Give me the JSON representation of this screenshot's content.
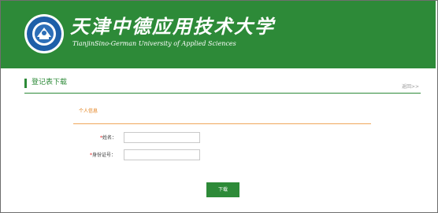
{
  "header": {
    "title_cn": "天津中德应用技术大学",
    "title_en": "TianjinSino-German University of Applied Sciences",
    "logo_text": "天津中德应用技术大学",
    "background": "#2d8a38"
  },
  "section": {
    "title": "登记表下载",
    "back_link": "返回>>"
  },
  "panel": {
    "title": "个人信息"
  },
  "form": {
    "name_label": "姓名：",
    "name_value": "",
    "id_label": "身份证号：",
    "id_value": "",
    "required_mark": "*"
  },
  "actions": {
    "download_label": "下载"
  },
  "colors": {
    "accent_green": "#2d8a38",
    "accent_orange": "#e27d14",
    "required_red": "#e02020"
  }
}
